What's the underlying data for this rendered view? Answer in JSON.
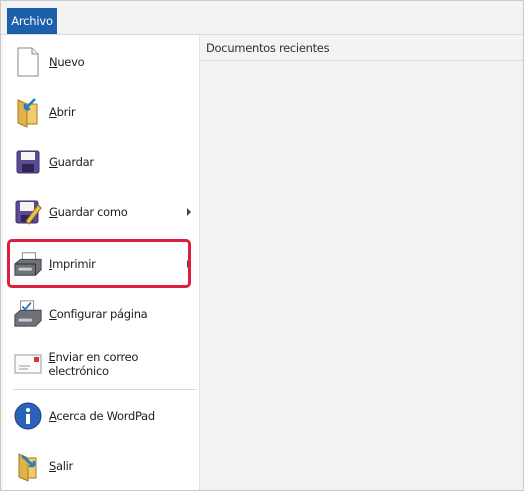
{
  "file_tab": "Archivo",
  "recent": {
    "title": "Documentos recientes"
  },
  "menu": {
    "items": [
      {
        "label": "Nuevo",
        "icon": "new-document-icon"
      },
      {
        "label": "Abrir",
        "icon": "open-folder-icon"
      },
      {
        "label": "Guardar",
        "icon": "save-disk-icon"
      },
      {
        "label": "Guardar como",
        "icon": "save-as-icon"
      },
      {
        "label": "Imprimir",
        "icon": "printer-icon"
      },
      {
        "label": "Configurar página",
        "icon": "page-setup-icon"
      },
      {
        "label": "Enviar en correo electrónico",
        "icon": "email-icon"
      },
      {
        "label": "Acerca de WordPad",
        "icon": "info-icon"
      },
      {
        "label": "Salir",
        "icon": "exit-icon"
      }
    ]
  },
  "colors": {
    "accent": "#1c5faa",
    "highlight": "#dc1f3c"
  }
}
